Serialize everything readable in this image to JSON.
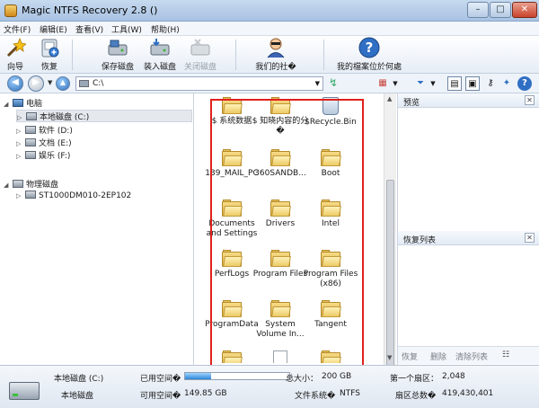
{
  "window": {
    "title": "Magic NTFS Recovery 2.8 ()"
  },
  "menu": [
    "文件(F)",
    "编辑(E)",
    "查看(V)",
    "工具(W)",
    "帮助(H)"
  ],
  "toolbar": {
    "wizard": "向导",
    "recover": "恢复",
    "save_disk": "保存磁盘",
    "mount_disk": "装入磁盘",
    "close_disk": "关闭磁盘",
    "our_community": "我们的社�",
    "my_files_where": "我的檔案位於何處"
  },
  "address": {
    "path": "C:\\"
  },
  "tree": {
    "computer": "电脑",
    "drives": [
      "本地磁盘 (C:)",
      "软件 (D:)",
      "文档 (E:)",
      "娱乐 (F:)"
    ],
    "physical": "物理磁盘",
    "physical_disk": "ST1000DM010-2EP102"
  },
  "files": [
    {
      "name": "$ 系统数据",
      "icon": "folder-icon"
    },
    {
      "name": "$ 知晓内容的分�",
      "icon": "folder-icon"
    },
    {
      "name": "$Recycle.Bin",
      "icon": "recycle-bin-icon"
    },
    {
      "name": "139_MAIL_PC",
      "icon": "folder-icon"
    },
    {
      "name": "360SANDB...",
      "icon": "folder-icon"
    },
    {
      "name": "Boot",
      "icon": "folder-icon"
    },
    {
      "name": "Documents and Settings",
      "icon": "folder-icon"
    },
    {
      "name": "Drivers",
      "icon": "folder-icon"
    },
    {
      "name": "Intel",
      "icon": "folder-icon"
    },
    {
      "name": "PerfLogs",
      "icon": "folder-icon"
    },
    {
      "name": "Program Files",
      "icon": "folder-icon"
    },
    {
      "name": "Program Files (x86)",
      "icon": "folder-icon"
    },
    {
      "name": "ProgramData",
      "icon": "folder-icon"
    },
    {
      "name": "System Volume In...",
      "icon": "folder-icon"
    },
    {
      "name": "Tangent",
      "icon": "folder-icon"
    }
  ],
  "panels": {
    "preview": "预览",
    "recovery_list": "恢复列表"
  },
  "recover_tools": {
    "recover": "恢复",
    "delete": "删除",
    "clear_list": "清除列表"
  },
  "status": {
    "drive_name": "本地磁盘 (C:)",
    "drive_type": "本地磁盘",
    "used_label": "已用空间�",
    "free_label": "可用空间�",
    "free_value": "149.85 GB",
    "total_label": "总大小：",
    "total_value": "200 GB",
    "fs_label": "文件系统�",
    "fs_value": "NTFS",
    "first_sector_label": "第一个扇区：",
    "first_sector_value": "2,048",
    "sector_total_label": "扇区总数�",
    "sector_total_value": "419,430,401",
    "used_fraction": 0.25
  },
  "colors": {
    "highlight": "#e0201c",
    "accent": "#2f86d8"
  }
}
